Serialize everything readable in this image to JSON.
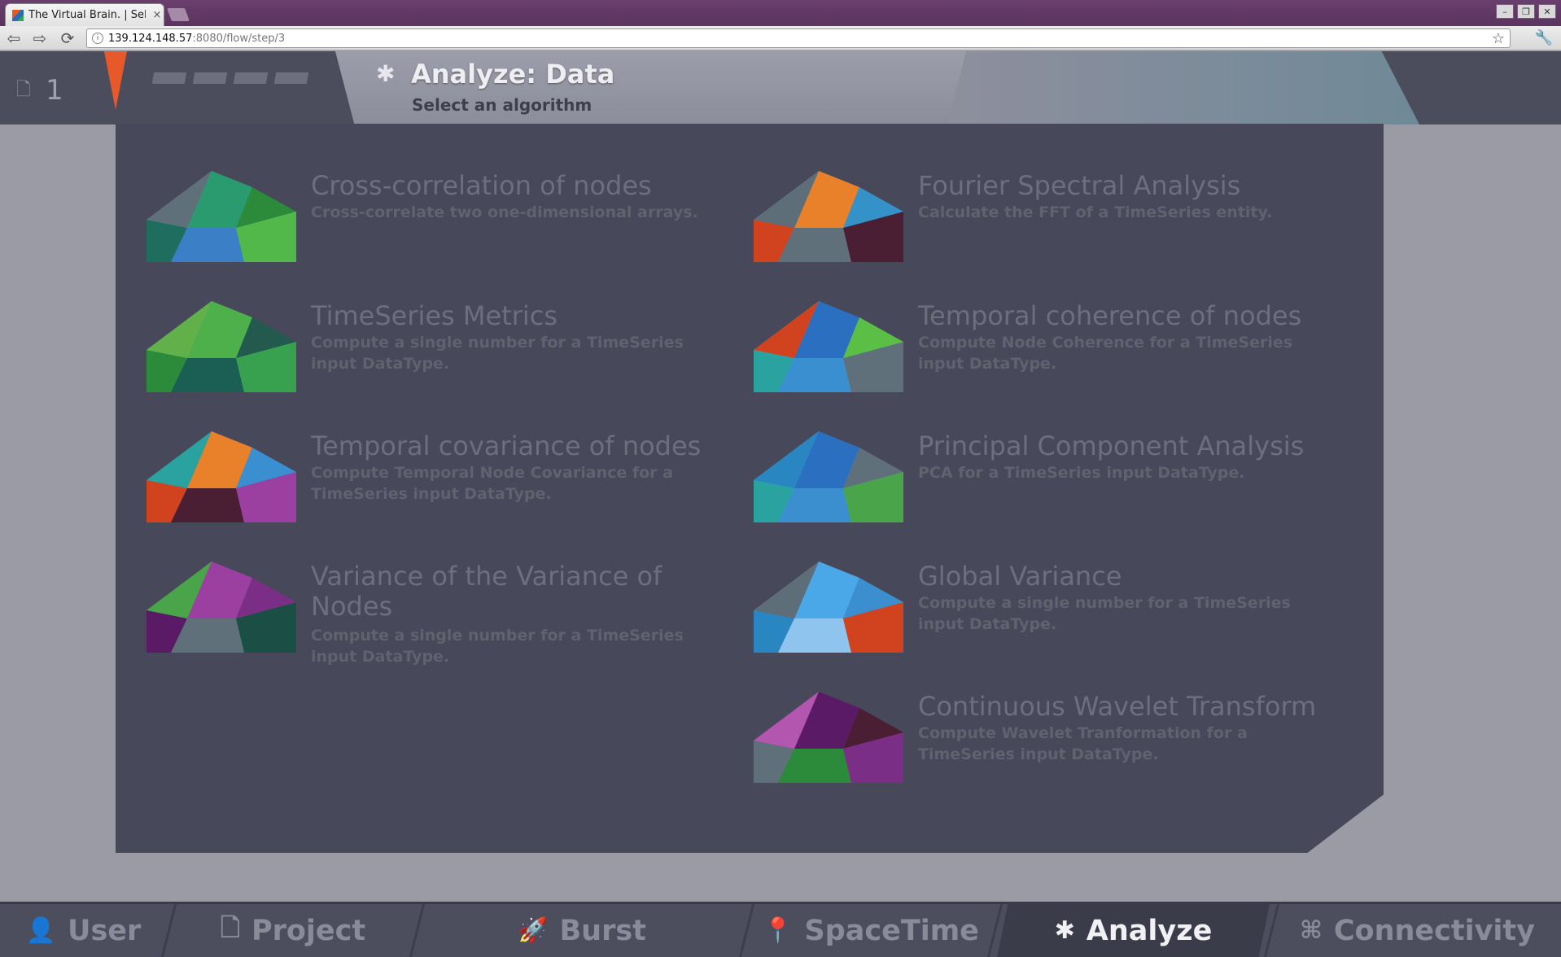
{
  "browser": {
    "tab_title": "The Virtual Brain. | Sele",
    "tab_close": "×",
    "url_host": "139.124.148.57",
    "url_path": ":8080/flow/step/3",
    "back_glyph": "⇦",
    "forward_glyph": "⇨",
    "reload_glyph": "⟳",
    "star_glyph": "☆",
    "wrench_glyph": "🔧",
    "win_minimize": "–",
    "win_restore": "❐",
    "win_close": "✕"
  },
  "header": {
    "project_count": "1",
    "page_title": "Analyze: Data",
    "page_subtitle": "Select an algorithm",
    "gear_glyph": "✱",
    "file_glyph": "🗋"
  },
  "algorithms": [
    {
      "title": "Cross-correlation of nodes",
      "description": "Cross-correlate two one-dimensional arrays.",
      "palette": [
        "#2aa3a0",
        "#2a9b6e",
        "#1f6d5e",
        "#3b7fc7",
        "#53b84a",
        "#2b8b3b",
        "#60707a"
      ]
    },
    {
      "title": "Fourier Spectral Analysis",
      "description": "Calculate the FFT of a TimeSeries entity.",
      "palette": [
        "#2a86c0",
        "#e8812a",
        "#d0431e",
        "#60707a",
        "#4a1f33",
        "#3492c8",
        "#5d6e79"
      ]
    },
    {
      "title": "TimeSeries Metrics",
      "description": "Compute a single number for a TimeSeries input DataType.",
      "palette": [
        "#2aa3a0",
        "#4eb04a",
        "#2b8b3b",
        "#1b5e54",
        "#38a150",
        "#245a4e",
        "#62b04a"
      ]
    },
    {
      "title": "Temporal coherence of nodes",
      "description": "Compute Node Coherence for a TimeSeries input DataType.",
      "palette": [
        "#4aa7e8",
        "#2a6fc0",
        "#2aa3a0",
        "#3a8fd0",
        "#60707a",
        "#5bbf45",
        "#d0431e"
      ]
    },
    {
      "title": "Temporal covariance of nodes",
      "description": "Compute Temporal Node Covariance for a TimeSeries input DataType.",
      "palette": [
        "#60707a",
        "#e8812a",
        "#d0431e",
        "#4a1f33",
        "#9b3fa0",
        "#3a8fd0",
        "#2aa3a0"
      ]
    },
    {
      "title": "Principal Component Analysis",
      "description": "PCA for a TimeSeries input DataType.",
      "palette": [
        "#4aa7e8",
        "#2a6fc0",
        "#2aa3a0",
        "#3b8fcf",
        "#4aa54a",
        "#60707a",
        "#2a86c0"
      ]
    },
    {
      "title": "Variance of the Variance of Nodes",
      "description": "Compute a single number for a TimeSeries input DataType.",
      "palette": [
        "#2b8b3b",
        "#9b3fa0",
        "#5a1a66",
        "#60707a",
        "#1b4e44",
        "#7b2e86",
        "#4aa54a"
      ]
    },
    {
      "title": "Global Variance",
      "description": "Compute a single number for a TimeSeries input DataType.",
      "palette": [
        "#60707a",
        "#4aa7e8",
        "#2a86c0",
        "#8ec4ee",
        "#d0431e",
        "#3b8fcf",
        "#5d6e79"
      ]
    },
    {
      "title": "Continuous Wavelet Transform",
      "description": "Compute Wavelet Tranformation for a TimeSeries input DataType.",
      "palette": [
        "#9b3fa0",
        "#5a1a66",
        "#60707a",
        "#2b8b3b",
        "#7b2e86",
        "#4a1f33",
        "#b356b0"
      ]
    }
  ],
  "bottom_nav": [
    {
      "label": "User",
      "icon": "👤",
      "active": false
    },
    {
      "label": "Project",
      "icon": "🗋",
      "active": false
    },
    {
      "label": "Burst",
      "icon": "🚀",
      "active": false
    },
    {
      "label": "SpaceTime",
      "icon": "📍",
      "active": false
    },
    {
      "label": "Analyze",
      "icon": "✱",
      "active": true
    },
    {
      "label": "Connectivity",
      "icon": "⌘",
      "active": false
    }
  ]
}
